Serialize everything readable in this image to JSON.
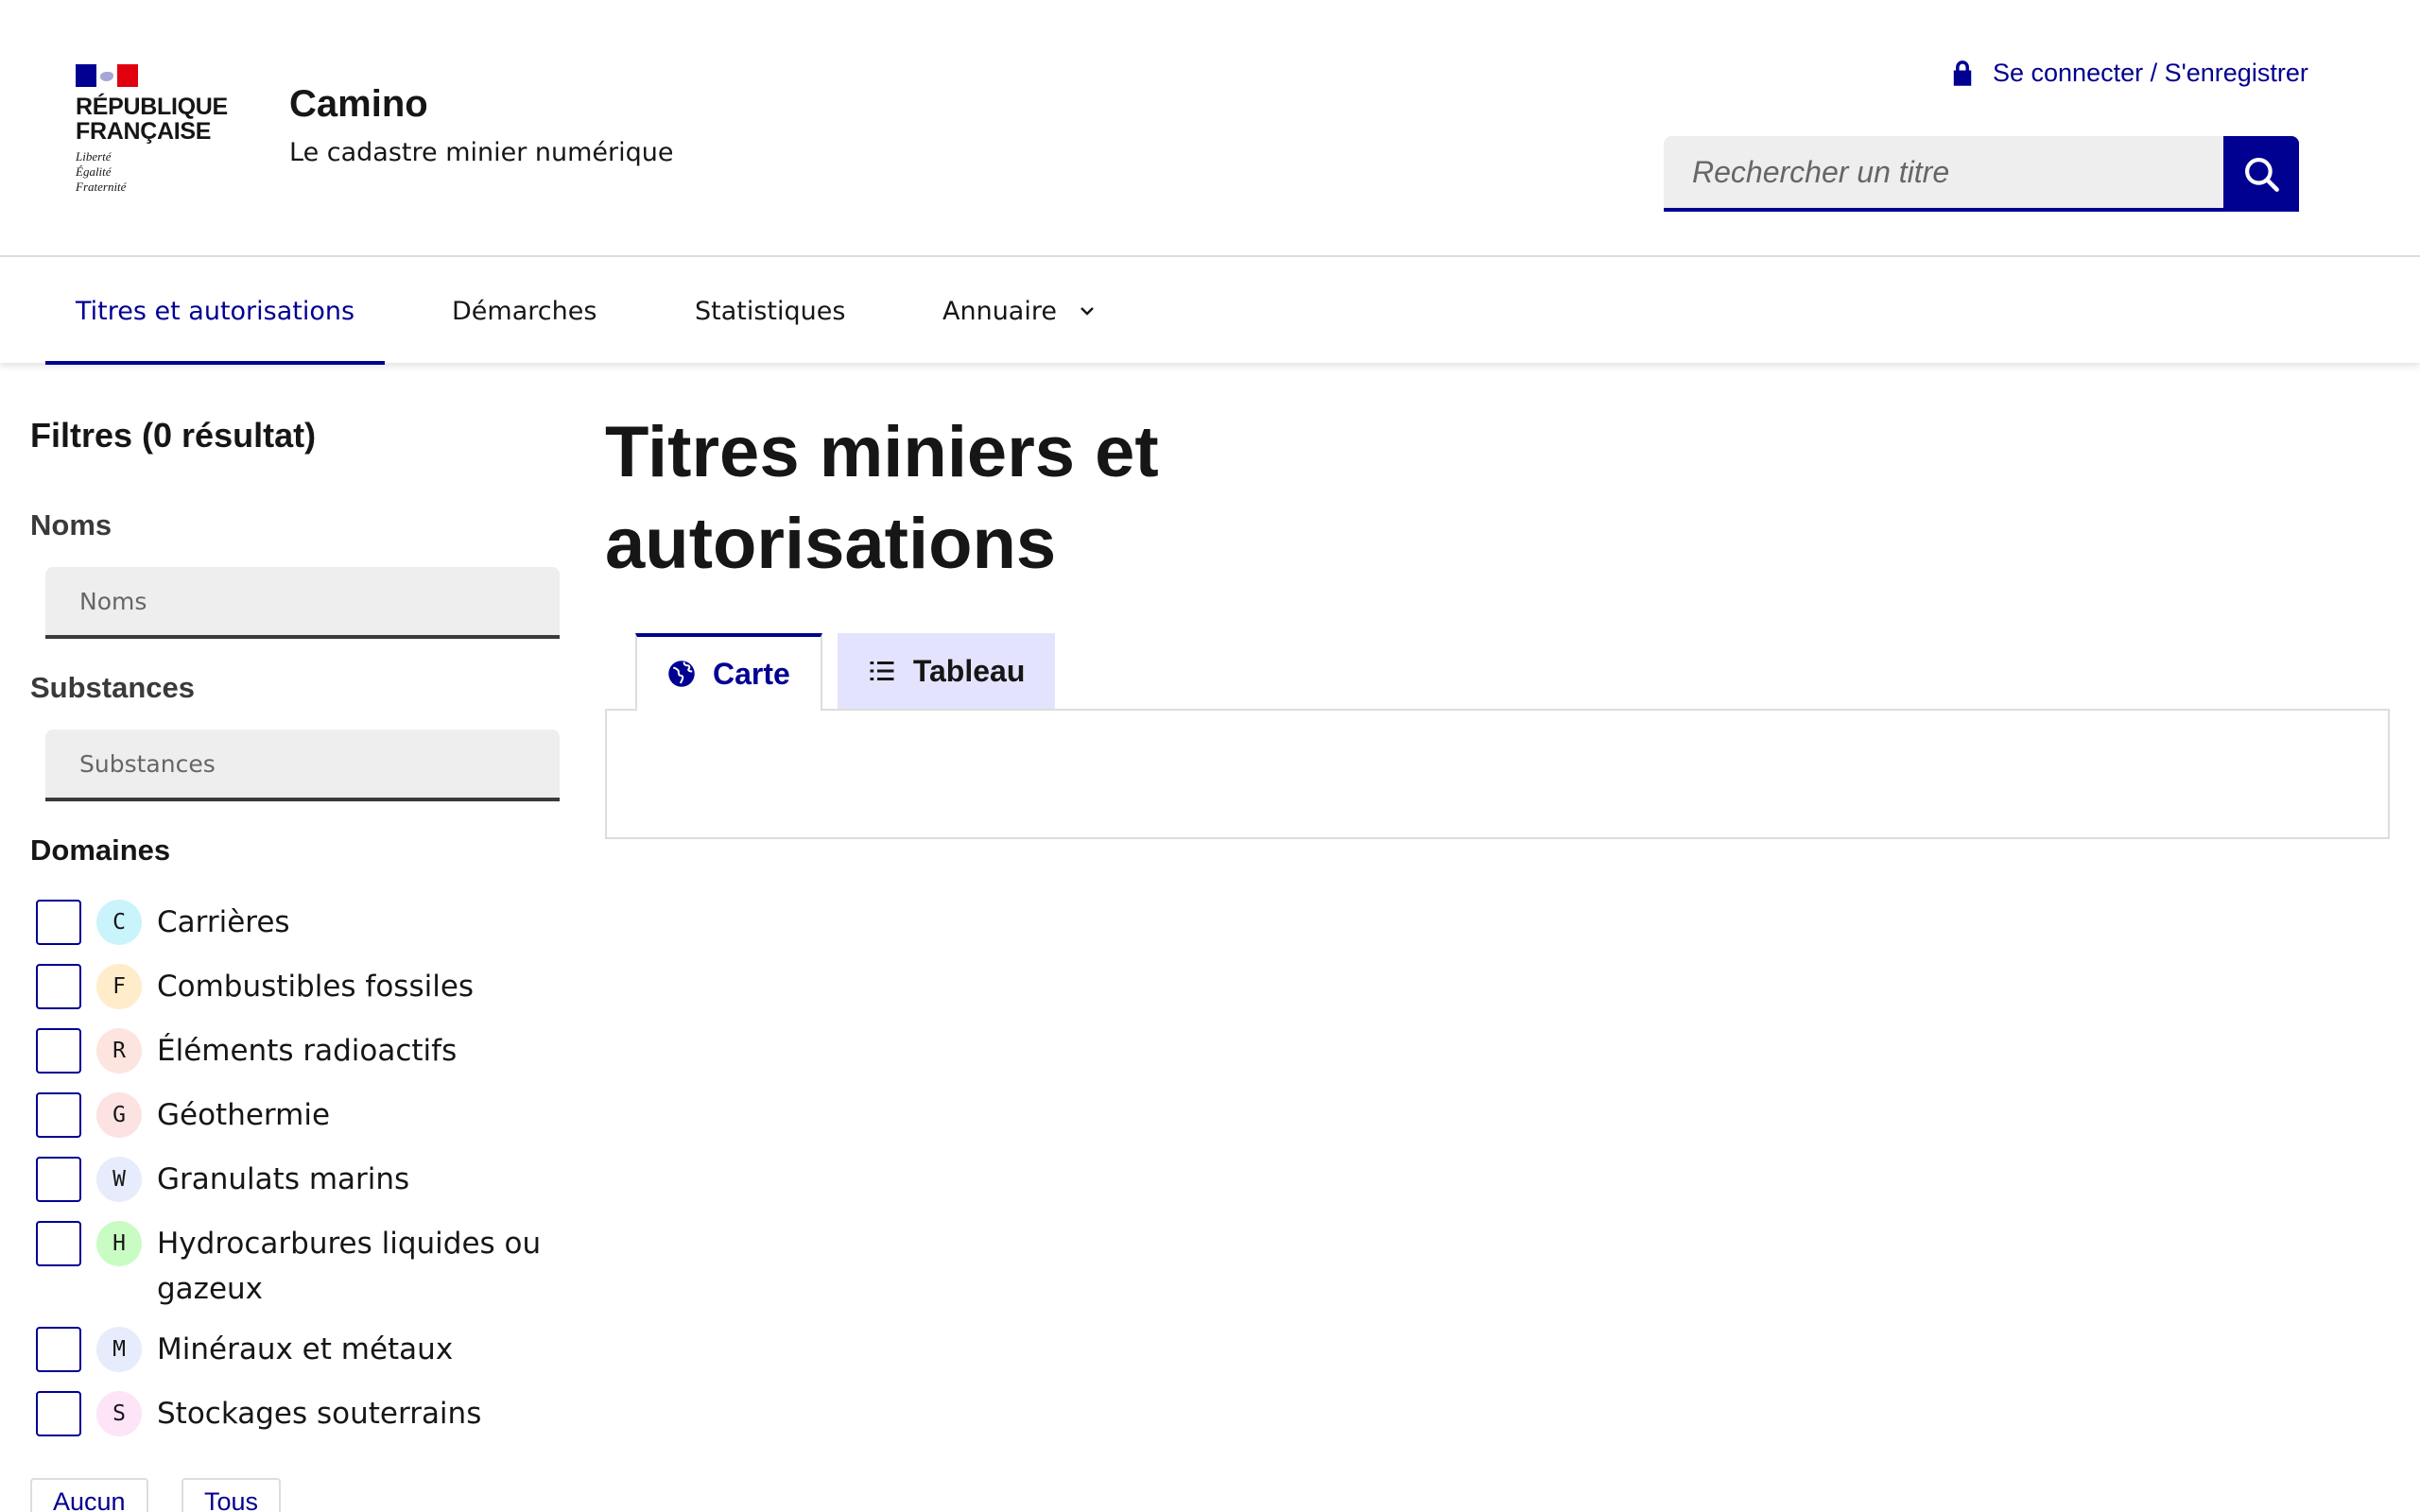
{
  "header": {
    "rf_name": "RÉPUBLIQUE\nFRANÇAISE",
    "rf_motto": "Liberté\nÉgalité\nFraternité",
    "service_title": "Camino",
    "service_tagline": "Le cadastre minier numérique",
    "login_label": "Se connecter / S'enregistrer",
    "search_placeholder": "Rechercher un titre"
  },
  "nav": {
    "items": [
      {
        "label": "Titres et autorisations",
        "active": true
      },
      {
        "label": "Démarches"
      },
      {
        "label": "Statistiques"
      },
      {
        "label": "Annuaire"
      }
    ]
  },
  "sidebar": {
    "filters_title": "Filtres (0 résultat)",
    "noms_label": "Noms",
    "noms_placeholder": "Noms",
    "substances_label": "Substances",
    "substances_placeholder": "Substances",
    "domaines_label": "Domaines",
    "domaines": [
      {
        "code": "C",
        "label": "Carrières",
        "color": "#c9f4fb"
      },
      {
        "code": "F",
        "label": "Combustibles fossiles",
        "color": "#feeccb"
      },
      {
        "code": "R",
        "label": "Éléments radioactifs",
        "color": "#fde4de"
      },
      {
        "code": "G",
        "label": "Géothermie",
        "color": "#fde2e2"
      },
      {
        "code": "W",
        "label": "Granulats marins",
        "color": "#e6ecfb"
      },
      {
        "code": "H",
        "label": "Hydrocarbures liquides ou gazeux",
        "color": "#c9fcc3"
      },
      {
        "code": "M",
        "label": "Minéraux et métaux",
        "color": "#e6ecfb"
      },
      {
        "code": "S",
        "label": "Stockages souterrains",
        "color": "#fde4f6"
      }
    ],
    "btn_none": "Aucun",
    "btn_all": "Tous"
  },
  "main": {
    "title": "Titres miniers et autorisations",
    "tabs": [
      {
        "label": "Carte",
        "active": true
      },
      {
        "label": "Tableau"
      }
    ]
  },
  "colors": {
    "accent": "#000091",
    "flag_red": "#e1000f",
    "tab_inactive_bg": "#e3e3fd"
  }
}
